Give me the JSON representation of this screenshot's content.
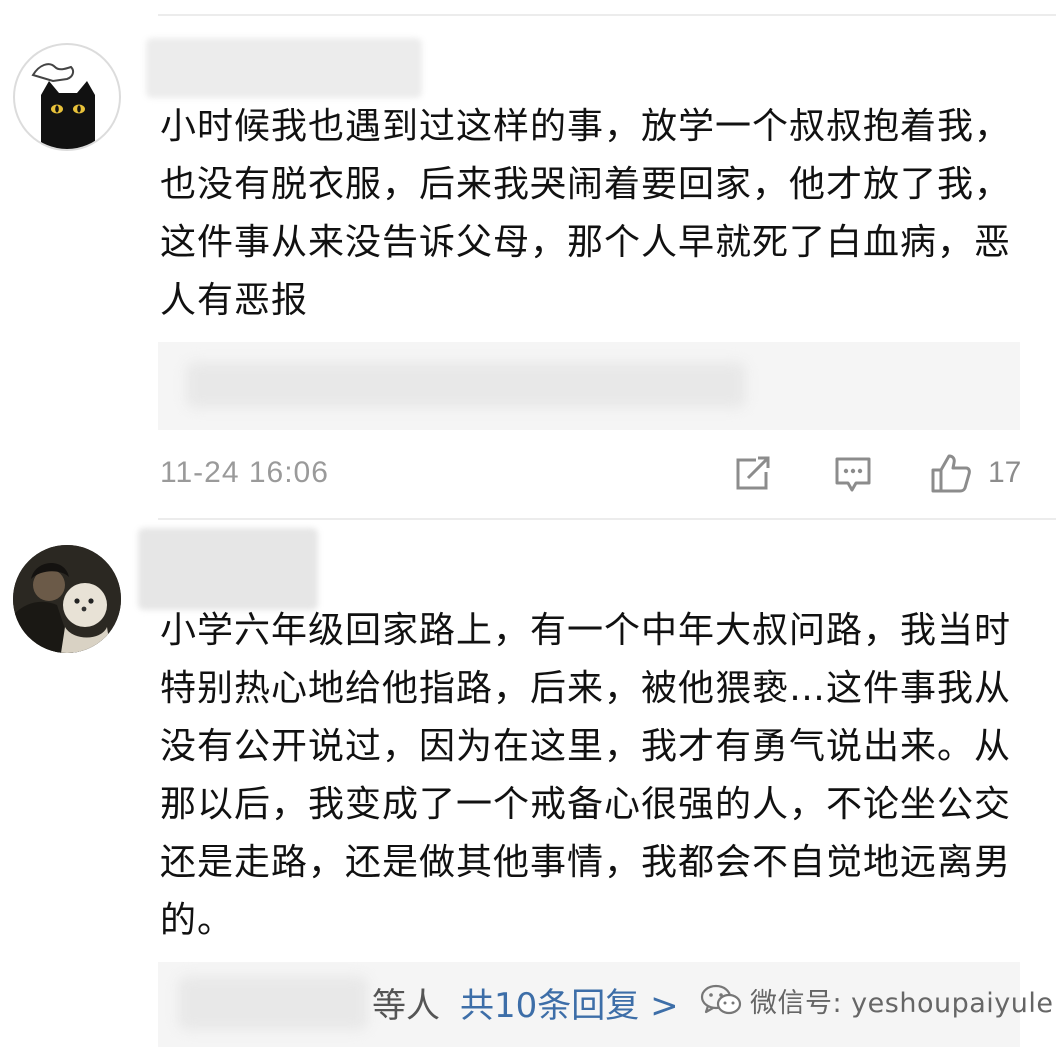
{
  "comments": [
    {
      "text": "小时候我也遇到过这样的事，放学一个叔叔抱着我，也没有脱衣服，后来我哭闹着要回家，他才放了我，这件事从来没告诉父母，那个人早就死了白血病，恶人有恶报",
      "timestamp": "11-24 16:06",
      "likes": "17",
      "avatar_icon": "black-cat-avatar"
    },
    {
      "text": "小学六年级回家路上，有一个中年大叔问路，我当时特别热心地给他指路，后来，被他猥亵…这件事我从没有公开说过，因为在这里，我才有勇气说出来。从那以后，我变成了一个戒备心很强的人，不论坐公交还是走路，还是做其他事情，我都会不自觉地远离男的。",
      "avatar_icon": "person-with-dog-avatar",
      "reply_summary": {
        "others": "等人",
        "more": "共10条回复 >"
      }
    }
  ],
  "watermark": {
    "icon": "wechat-icon",
    "text": "微信号: yeshoupaiyule"
  },
  "colors": {
    "link": "#3d6ea8",
    "meta": "#9a9a9a",
    "reply_bg": "#f5f5f5"
  }
}
